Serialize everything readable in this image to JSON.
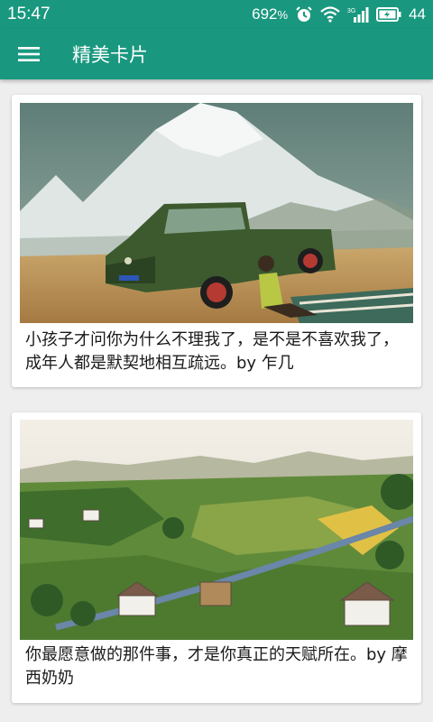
{
  "status_bar": {
    "time": "15:47",
    "speed": "692",
    "speed_unit": "%",
    "battery": "44",
    "icons": [
      "alarm-icon",
      "wifi-icon",
      "signal-icon",
      "battery-icon"
    ]
  },
  "app_bar": {
    "title": "精美卡片",
    "menu_icon": "hamburger-menu-icon"
  },
  "cards": [
    {
      "image": "illustration of a green pickup truck parked before a snowy mountain with a person lying on a blanket",
      "text": "小孩子才问你为什么不理我了，是不是不喜欢我了，成年人都是默契地相互疏远。by 乍几"
    },
    {
      "image": "folk-art painting of a green valley village with houses, river and hills",
      "text": "你最愿意做的那件事，才是你真正的天赋所在。by 摩西奶奶"
    }
  ],
  "colors": {
    "primary": "#19987f",
    "background": "#eeeeee",
    "card": "#ffffff"
  }
}
